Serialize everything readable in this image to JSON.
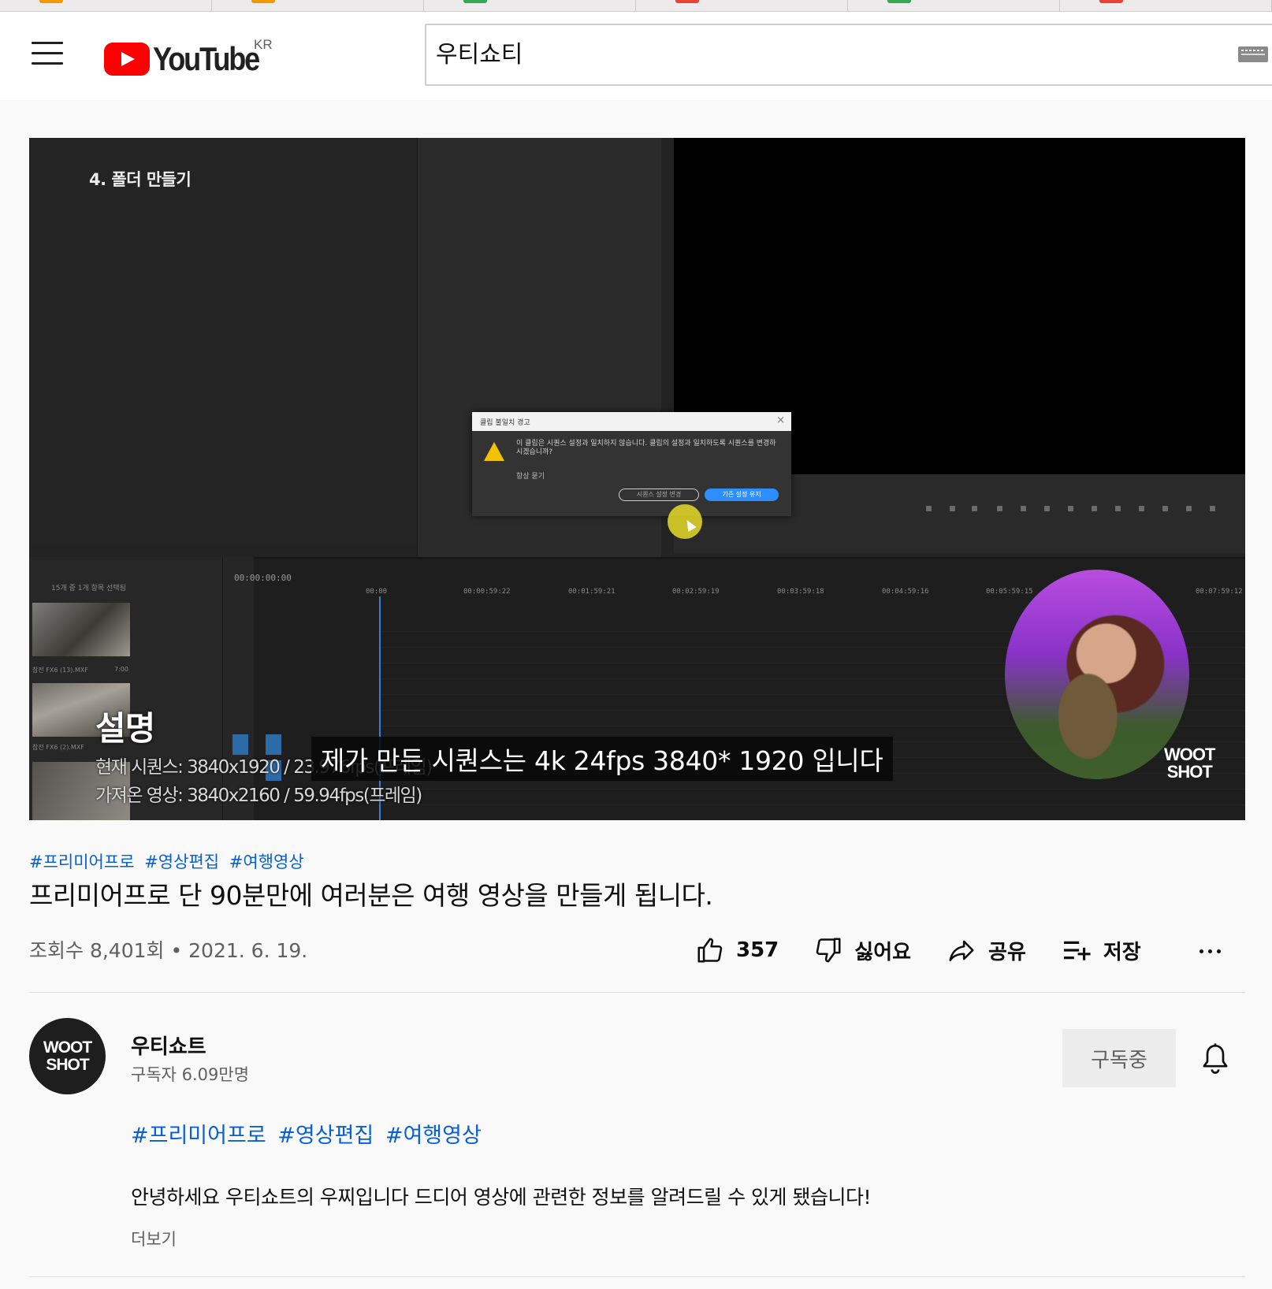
{
  "browser": {
    "tab_accents": [
      "#f29900",
      "#f29900",
      "#34a853",
      "#ea4335",
      "#34a853",
      "#ea4335"
    ]
  },
  "masthead": {
    "logo_text": "YouTube",
    "country_code": "KR",
    "search_value": "우티쇼티"
  },
  "player": {
    "video_overlay_heading": "4. 폴더 만들기",
    "dialog": {
      "title": "클립 불일치 경고",
      "message": "이 클립은 시퀀스 설정과 일치하지 않습니다. 클립의 설정과 일치하도록 시퀀스를 변경하시겠습니까?",
      "checkbox": "항상 묻기",
      "button_change": "시퀀스 설정 변경",
      "button_keep": "기존 설정 유지"
    },
    "timecode": "00:00:00:00",
    "ruler_ticks": [
      "00:00",
      "00:00:59:22",
      "00:01:59:21",
      "00:02:59:19",
      "00:03:59:18",
      "00:04:59:16",
      "00:05:59:15",
      "00:07:59:12"
    ],
    "project_count": "15개 중 1개 항목 선택됨",
    "clip_names": [
      "참전 FX6 (13).MXF",
      "참전 FX6 (2).MXF"
    ],
    "clip_duration": "7:00",
    "description_overlay": {
      "heading": "설명",
      "line1": "현재 시퀀스: 3840x1920 / 23.976fps(프레임)",
      "line2": "가져온 영상: 3840x2160 / 59.94fps(프레임)"
    },
    "watermark": [
      "WOOT",
      "SHOT"
    ],
    "subtitle": "제가 만든 시퀀스는 4k 24fps 3840* 1920 입니다"
  },
  "video": {
    "hashtags": [
      "#프리미어프로",
      "#영상편집",
      "#여행영상"
    ],
    "title": "프리미어프로 단 90분만에 여러분은 여행 영상을 만들게 됩니다.",
    "view_info": "조회수 8,401회 • 2021. 6. 19.",
    "actions": {
      "like_count": "357",
      "dislike_label": "싫어요",
      "share_label": "공유",
      "save_label": "저장"
    }
  },
  "channel": {
    "avatar_text": [
      "WOOT",
      "SHOT"
    ],
    "name": "우티쇼트",
    "subscribers": "구독자 6.09만명",
    "subscribe_label": "구독중"
  },
  "description": {
    "hashtags": [
      "#프리미어프로",
      "#영상편집",
      "#여행영상"
    ],
    "text": "안녕하세요 우티쇼트의 우찌입니다 드디어 영상에 관련한 정보를 알려드릴 수 있게 됐습니다!",
    "show_more": "더보기"
  },
  "colors": {
    "brand_red": "#ff0000",
    "link_blue": "#065fd4",
    "secondary_text": "#606060"
  }
}
